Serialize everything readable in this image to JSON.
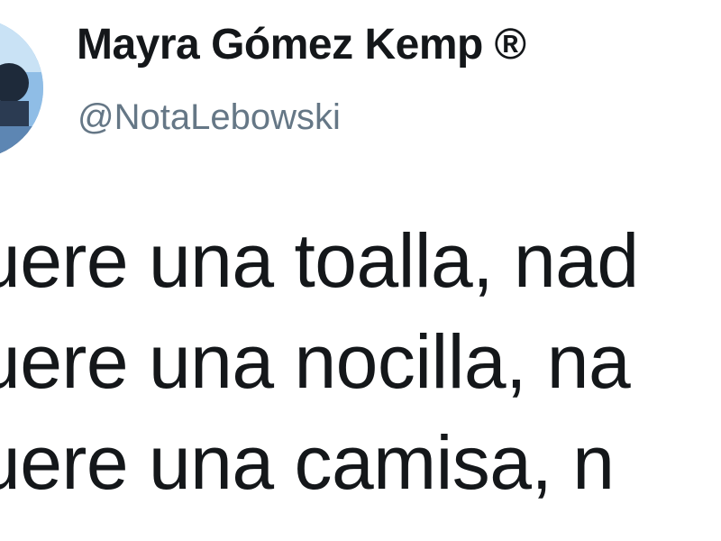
{
  "author": {
    "display_name": "Mayra Gómez Kemp ®",
    "handle": "@NotaLebowski",
    "avatar_icon": "profile-photo-icon"
  },
  "tweet": {
    "lines": [
      "uere una toalla, nad",
      "uere una nocilla, na",
      "uere una camisa, n"
    ]
  },
  "colors": {
    "name": "#14171a",
    "handle": "#657786",
    "text": "#14171a",
    "background": "#ffffff"
  }
}
